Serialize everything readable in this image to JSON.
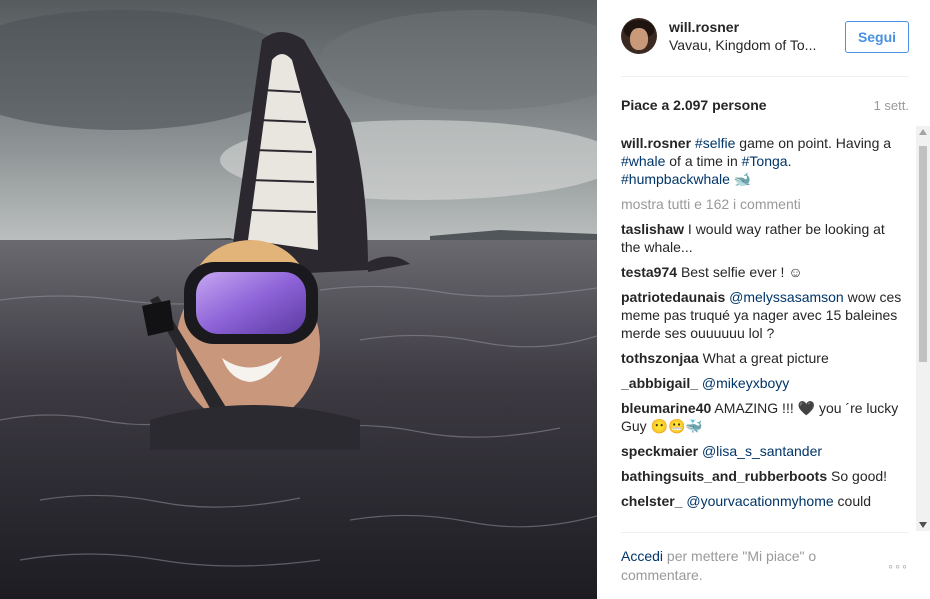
{
  "post": {
    "username": "will.rosner",
    "location": "Vavau, Kingdom of To...",
    "follow_label": "Segui",
    "likes": "Piace a 2.097 persone",
    "time": "1 sett."
  },
  "caption": {
    "username": "will.rosner",
    "parts": [
      "#selfie",
      "game on point. Having a",
      "#whale",
      "of a time in",
      "#Tonga",
      ".",
      "#humpbackwhale",
      "🐋"
    ]
  },
  "show_all": "mostra tutti e 162 i commenti",
  "comments": [
    {
      "user": "taslishaw",
      "text": "I would way rather be looking at the whale..."
    },
    {
      "user": "testa974",
      "text": "Best selfie ever ! ☺"
    },
    {
      "user": "patriotedaunais",
      "mention": "@melyssasamson",
      "text": "wow ces meme pas truqué ya nager avec 15 baleines merde ses ouuuuuu lol ?"
    },
    {
      "user": "tothszonjaa",
      "text": "What a great picture"
    },
    {
      "user": "_abbbigail_",
      "mention": "@mikeyxboyy",
      "text": ""
    },
    {
      "user": "bleumarine40",
      "text": "AMAZING !!! 🖤 you ´re lucky Guy 😶😬🐳"
    },
    {
      "user": "speckmaier",
      "mention": "@lisa_s_santander",
      "text": ""
    },
    {
      "user": "bathingsuits_and_rubberboots",
      "text": "So good!"
    },
    {
      "user": "chelster_",
      "mention": "@yourvacationmyhome",
      "text": "could"
    }
  ],
  "footer": {
    "login": "Accedi",
    "rest": "per mettere \"Mi piace\" o commentare.",
    "more": "◦◦◦"
  }
}
